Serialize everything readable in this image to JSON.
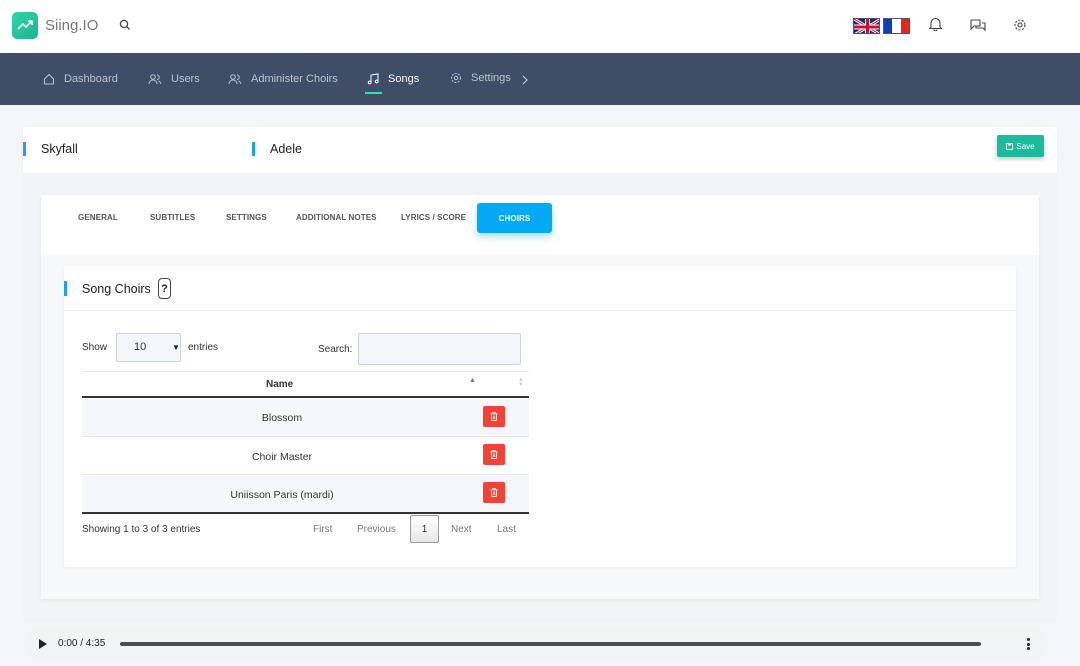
{
  "app": {
    "brand": "Siing.IO"
  },
  "header": {
    "icons": [
      "search-icon",
      "uk-flag",
      "fr-flag",
      "bell-icon",
      "chat-icon",
      "gear-icon"
    ]
  },
  "nav": {
    "items": [
      {
        "label": "Dashboard",
        "icon": "home-icon"
      },
      {
        "label": "Users",
        "icon": "users-icon"
      },
      {
        "label": "Administer Choirs",
        "icon": "users-icon"
      },
      {
        "label": "Songs",
        "icon": "music-icon",
        "active": true
      },
      {
        "label": "Settings",
        "icon": "gear-icon"
      }
    ]
  },
  "song": {
    "title": "Skyfall",
    "artist": "Adele",
    "save_label": "Save"
  },
  "tabs": [
    {
      "label": "GENERAL"
    },
    {
      "label": "SUBTITLES"
    },
    {
      "label": "SETTINGS"
    },
    {
      "label": "ADDITIONAL NOTES"
    },
    {
      "label": "LYRICS / SCORE"
    },
    {
      "label": "CHOIRS",
      "active": true
    }
  ],
  "choirs": {
    "heading": "Song Choirs",
    "help": "?",
    "show_label": "Show",
    "page_size": "10",
    "entries_label": "entries",
    "search_label": "Search:",
    "search_value": "",
    "column_name": "Name",
    "rows": [
      {
        "name": "Blossom"
      },
      {
        "name": "Choir Master"
      },
      {
        "name": "Uniisson Paris (mardi)"
      }
    ],
    "info": "Showing 1 to 3 of 3 entries",
    "pagination": {
      "first": "First",
      "previous": "Previous",
      "current": "1",
      "next": "Next",
      "last": "Last"
    }
  },
  "player": {
    "time": "0:00 / 4:35"
  },
  "colors": {
    "accent": "#04a9f5",
    "nav_bg": "#3f4d67",
    "save": "#1abc9c",
    "delete": "#f44236"
  }
}
